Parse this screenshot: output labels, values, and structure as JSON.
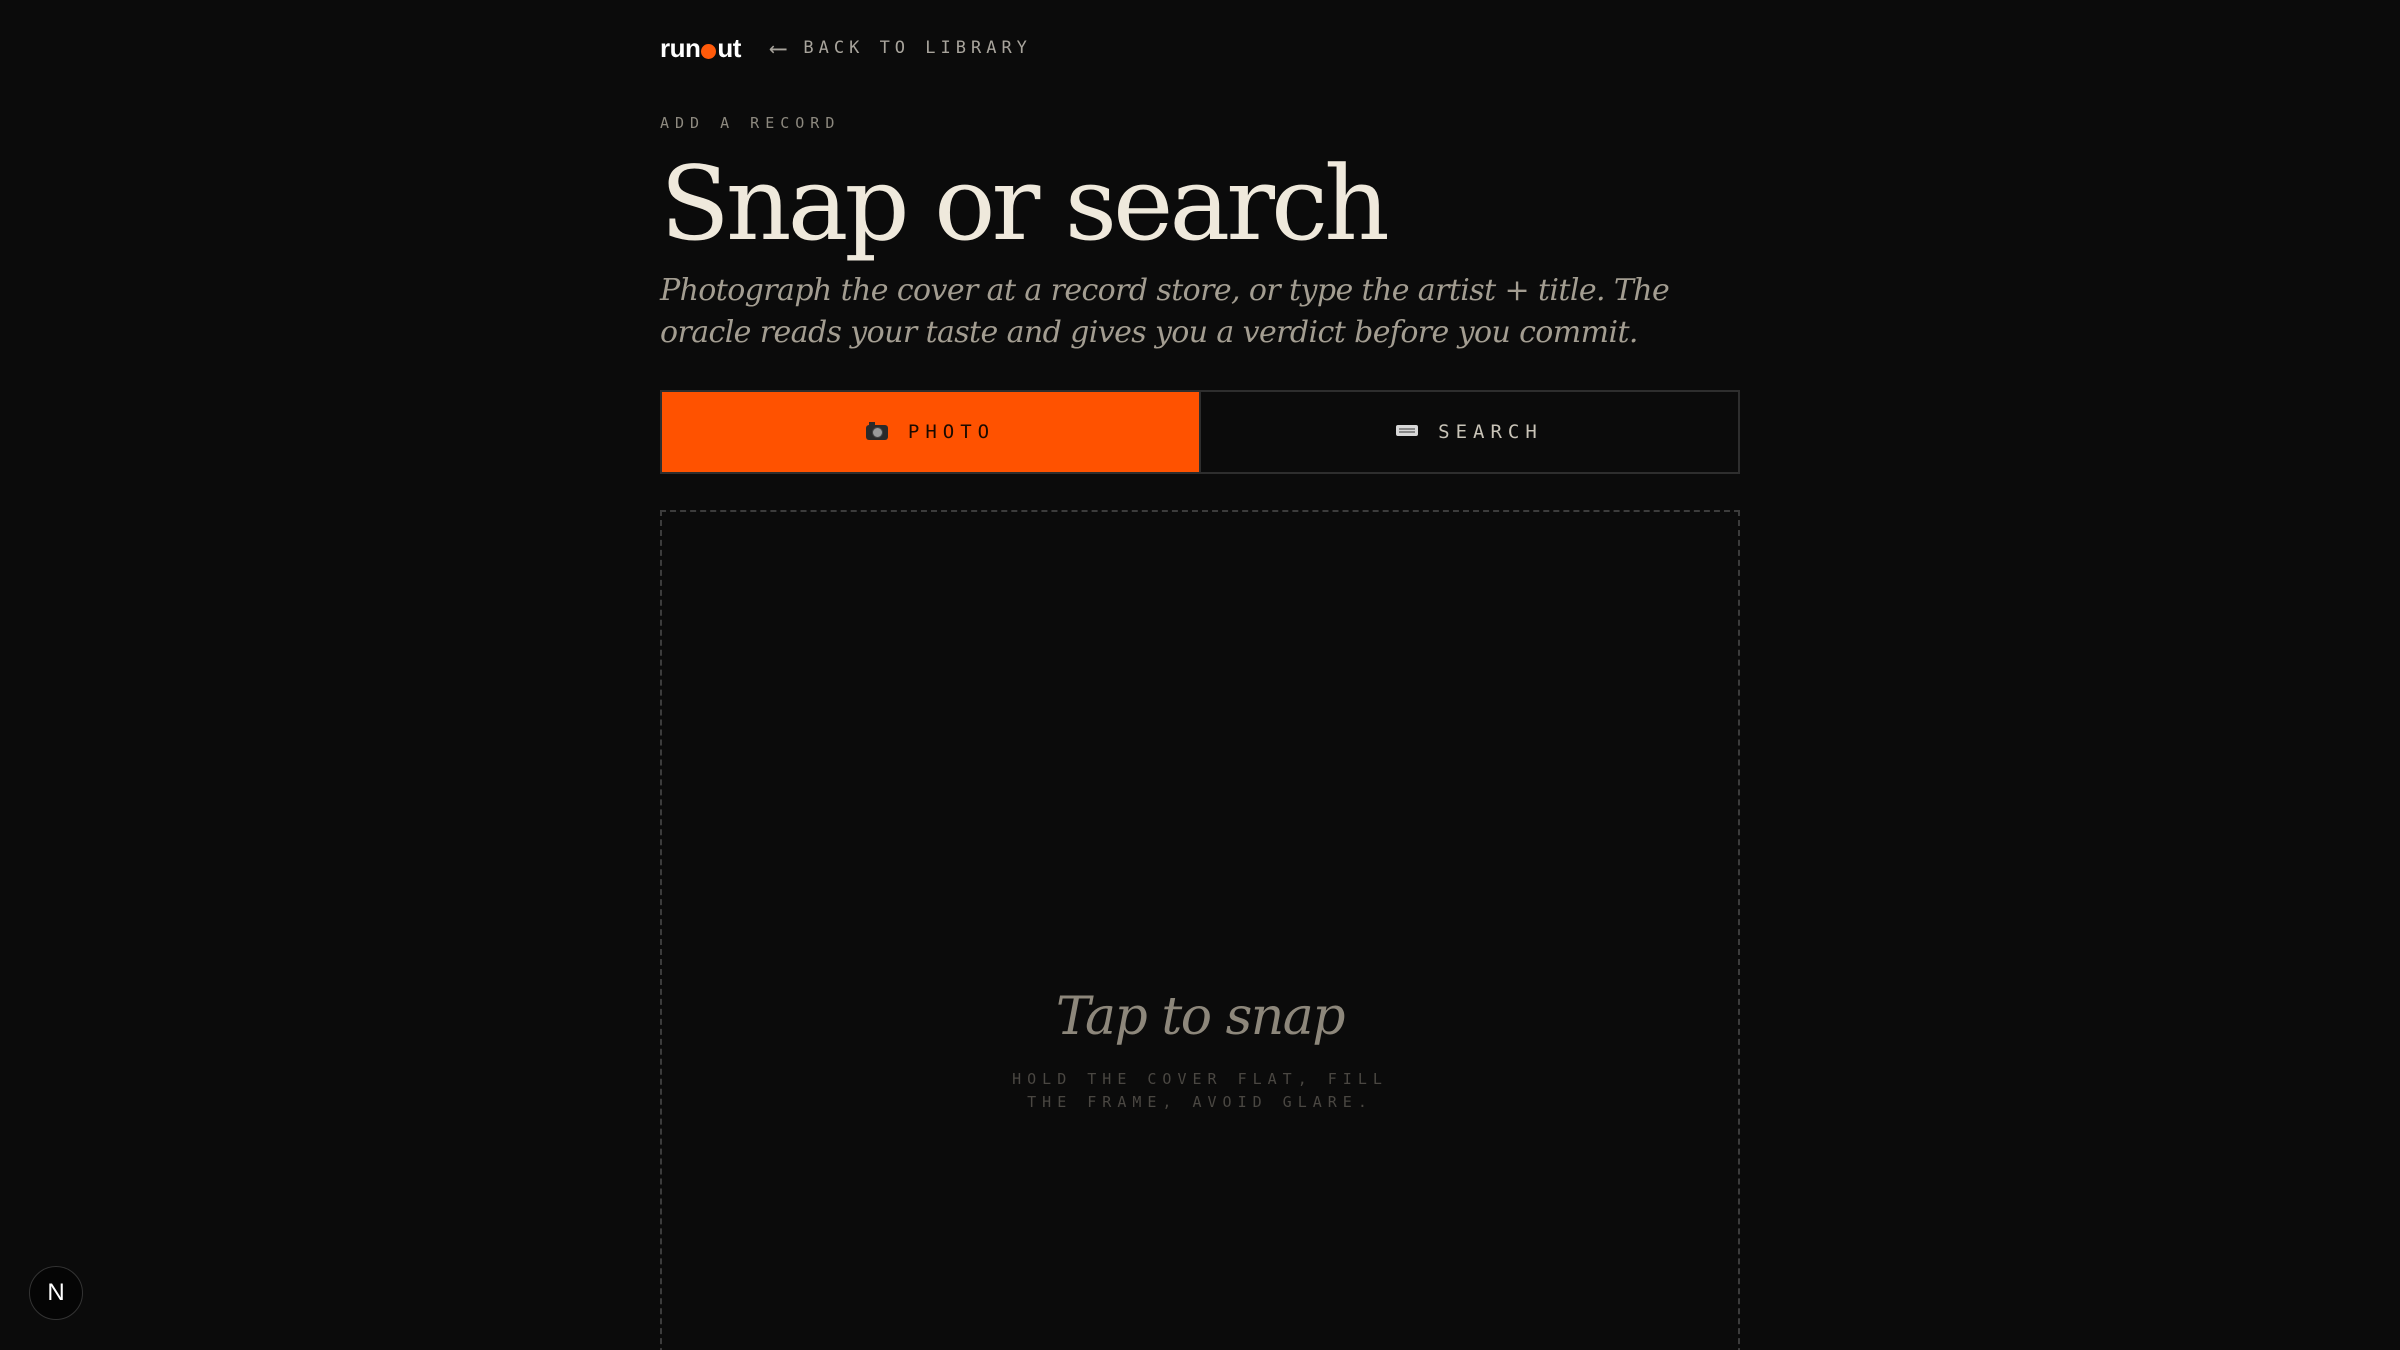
{
  "brand": {
    "logo_text_before": "run",
    "logo_text_after": "ut"
  },
  "nav": {
    "back_arrow": "⟵",
    "back_label": "BACK TO LIBRARY"
  },
  "header": {
    "eyebrow": "ADD A RECORD",
    "title": "Snap or search",
    "subtitle": "Photograph the cover at a record store, or type the artist + title. The oracle reads your taste and gives you a verdict before you commit."
  },
  "tabs": [
    {
      "label": "PHOTO",
      "icon": "camera-icon",
      "active": true
    },
    {
      "label": "SEARCH",
      "icon": "keyboard-icon",
      "active": false
    }
  ],
  "dropzone": {
    "title": "Tap to snap",
    "hint": "HOLD THE COVER FLAT, FILL THE FRAME, AVOID GLARE."
  },
  "dev_badge": {
    "letter": "N",
    "icon": "nextjs-icon"
  },
  "colors": {
    "background": "#0b0b0b",
    "accent": "#ff5200",
    "title_text": "#efe9dc"
  }
}
